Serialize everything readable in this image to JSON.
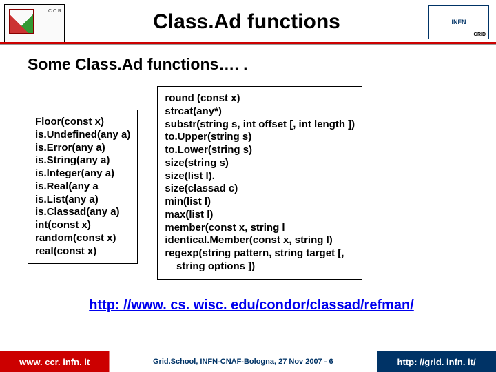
{
  "header": {
    "title": "Class.Ad functions",
    "logo_left_text": "C\nC\nR",
    "logo_right_text": "INFN"
  },
  "subtitle": "Some Class.Ad functions…. .",
  "box_left": "Floor(const x)\nis.Undefined(any a)\nis.Error(any a)\nis.String(any a)\nis.Integer(any a)\nis.Real(any a\nis.List(any a)\nis.Classad(any a)\nint(const x)\nrandom(const x)\nreal(const x)",
  "box_right": "round (const x)\nstrcat(any*)\nsubstr(string s, int offset [, int length ])\nto.Upper(string s)\nto.Lower(string s)\nsize(string s)\nsize(list l).\nsize(classad c)\nmin(list l)\nmax(list l)\nmember(const x, string l\nidentical.Member(const x, string l)\nregexp(string pattern, string target [,\n    string options ])",
  "ref_link": "http: //www. cs. wisc. edu/condor/classad/refman/",
  "footer": {
    "left": "www. ccr. infn. it",
    "mid": "Grid.School, INFN-CNAF-Bologna, 27 Nov 2007  -  6",
    "right": "http: //grid. infn. it/"
  }
}
